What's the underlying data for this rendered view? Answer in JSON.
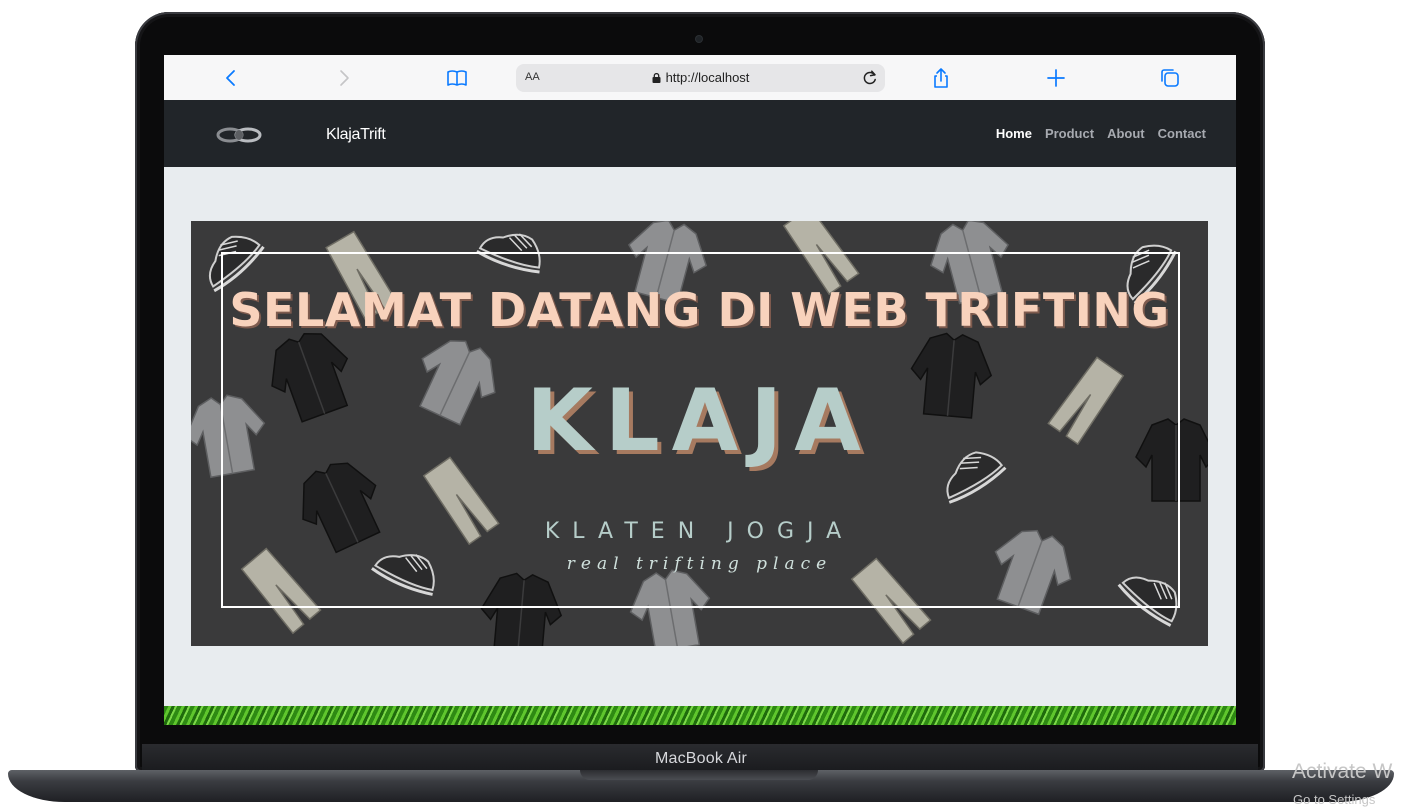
{
  "device": {
    "label": "MacBook Air"
  },
  "browser": {
    "text_size_label": "AA",
    "url": "http://localhost",
    "icons": [
      "back-icon",
      "forward-icon",
      "bookmarks-icon",
      "lock-icon",
      "reload-icon",
      "share-icon",
      "new-tab-icon",
      "tabs-icon"
    ]
  },
  "site": {
    "brand": "KlajaTrift",
    "nav": [
      {
        "label": "Home",
        "active": true
      },
      {
        "label": "Product",
        "active": false
      },
      {
        "label": "About",
        "active": false
      },
      {
        "label": "Contact",
        "active": false
      }
    ]
  },
  "banner": {
    "headline": "SELAMAT DATANG DI WEB TRIFTING",
    "title": "KLAJA",
    "subtitle": "KLATEN JOGJA",
    "tagline": "real trifting place"
  },
  "os_watermark": {
    "line1": "Activate W",
    "line2": "Go to Settings"
  },
  "colors": {
    "navbar": "#212529",
    "page_bg": "#e8ecef",
    "banner_bg": "#3a3a3b",
    "headline": "#f8d2bc",
    "title": "#b6cdc9",
    "accent_blue": "#0a7aff"
  }
}
